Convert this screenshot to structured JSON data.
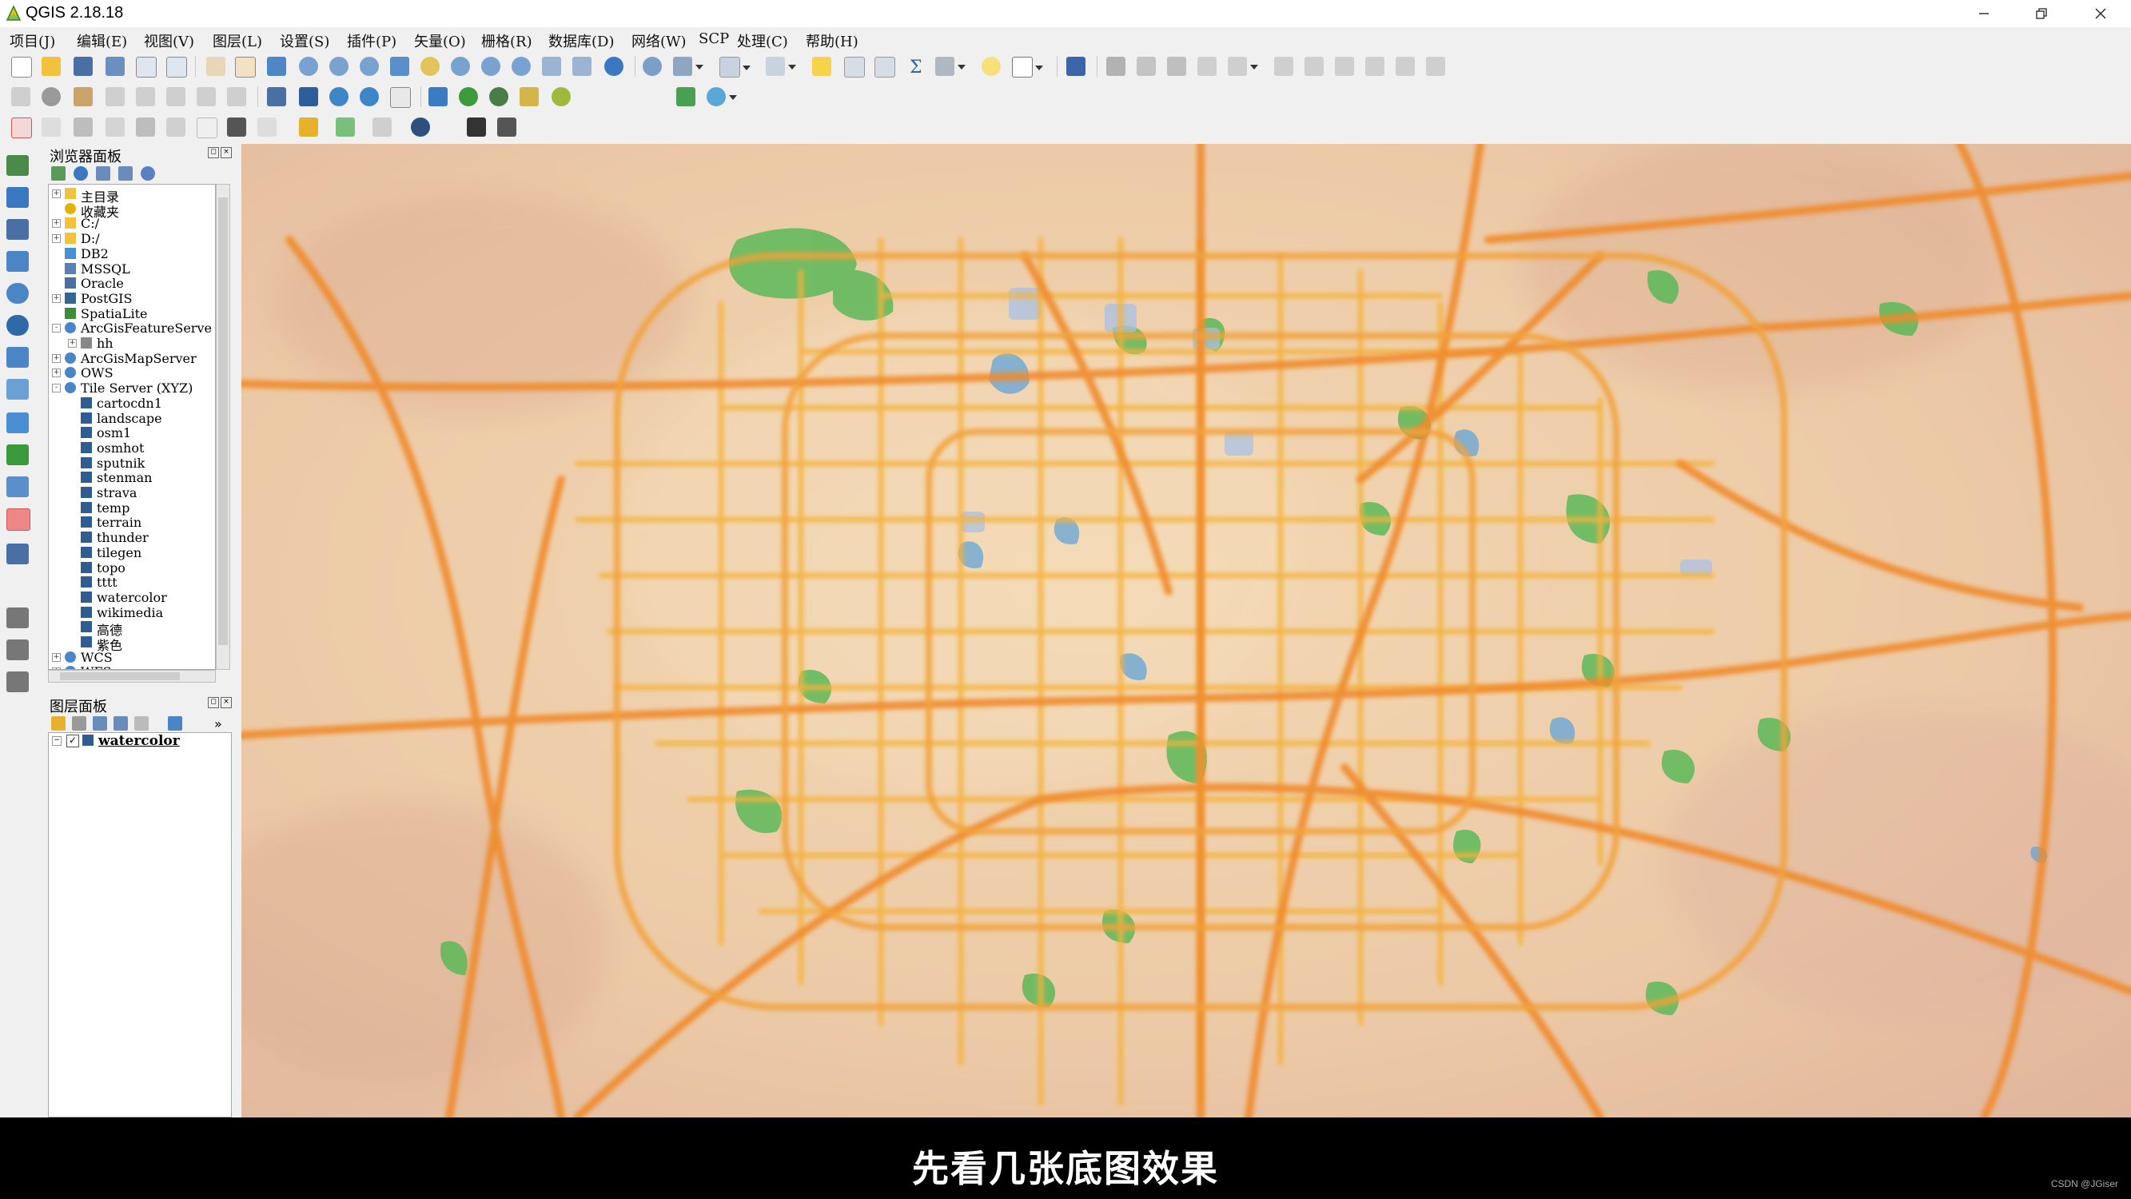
{
  "window": {
    "title": "QGIS 2.18.18"
  },
  "menu": [
    "项目(J)",
    "编辑(E)",
    "视图(V)",
    "图层(L)",
    "设置(S)",
    "插件(P)",
    "矢量(O)",
    "栅格(R)",
    "数据库(D)",
    "网络(W)",
    "SCP",
    "处理(C)",
    "帮助(H)"
  ],
  "browser_panel": {
    "title": "浏览器面板",
    "items": [
      {
        "label": "主目录",
        "level": 0,
        "expander": "+",
        "icon": "folder-icon"
      },
      {
        "label": "收藏夹",
        "level": 0,
        "expander": "",
        "icon": "star-icon"
      },
      {
        "label": "C:/",
        "level": 0,
        "expander": "+",
        "icon": "folder-icon"
      },
      {
        "label": "D:/",
        "level": 0,
        "expander": "+",
        "icon": "folder-icon"
      },
      {
        "label": "DB2",
        "level": 0,
        "expander": "",
        "icon": "db2-icon"
      },
      {
        "label": "MSSQL",
        "level": 0,
        "expander": "",
        "icon": "mssql-icon"
      },
      {
        "label": "Oracle",
        "level": 0,
        "expander": "",
        "icon": "oracle-icon"
      },
      {
        "label": "PostGIS",
        "level": 0,
        "expander": "+",
        "icon": "postgis-icon"
      },
      {
        "label": "SpatiaLite",
        "level": 0,
        "expander": "",
        "icon": "spatialite-icon"
      },
      {
        "label": "ArcGisFeatureServe",
        "level": 0,
        "expander": "-",
        "icon": "globe-icon"
      },
      {
        "label": "hh",
        "level": 1,
        "expander": "+",
        "icon": "connection-icon"
      },
      {
        "label": "ArcGisMapServer",
        "level": 0,
        "expander": "+",
        "icon": "globe-icon"
      },
      {
        "label": "OWS",
        "level": 0,
        "expander": "+",
        "icon": "globe-icon"
      },
      {
        "label": "Tile Server (XYZ)",
        "level": 0,
        "expander": "-",
        "icon": "globe-icon"
      },
      {
        "label": "cartocdn1",
        "level": 1,
        "expander": "",
        "icon": "tile-icon"
      },
      {
        "label": "landscape",
        "level": 1,
        "expander": "",
        "icon": "tile-icon"
      },
      {
        "label": "osm1",
        "level": 1,
        "expander": "",
        "icon": "tile-icon"
      },
      {
        "label": "osmhot",
        "level": 1,
        "expander": "",
        "icon": "tile-icon"
      },
      {
        "label": "sputnik",
        "level": 1,
        "expander": "",
        "icon": "tile-icon"
      },
      {
        "label": "stenman",
        "level": 1,
        "expander": "",
        "icon": "tile-icon"
      },
      {
        "label": "strava",
        "level": 1,
        "expander": "",
        "icon": "tile-icon"
      },
      {
        "label": "temp",
        "level": 1,
        "expander": "",
        "icon": "tile-icon"
      },
      {
        "label": "terrain",
        "level": 1,
        "expander": "",
        "icon": "tile-icon"
      },
      {
        "label": "thunder",
        "level": 1,
        "expander": "",
        "icon": "tile-icon"
      },
      {
        "label": "tilegen",
        "level": 1,
        "expander": "",
        "icon": "tile-icon"
      },
      {
        "label": "topo",
        "level": 1,
        "expander": "",
        "icon": "tile-icon"
      },
      {
        "label": "tttt",
        "level": 1,
        "expander": "",
        "icon": "tile-icon"
      },
      {
        "label": "watercolor",
        "level": 1,
        "expander": "",
        "icon": "tile-icon"
      },
      {
        "label": "wikimedia",
        "level": 1,
        "expander": "",
        "icon": "tile-icon"
      },
      {
        "label": "高德",
        "level": 1,
        "expander": "",
        "icon": "tile-icon"
      },
      {
        "label": "紫色",
        "level": 1,
        "expander": "",
        "icon": "tile-icon"
      },
      {
        "label": "WCS",
        "level": 0,
        "expander": "+",
        "icon": "globe-icon"
      },
      {
        "label": "WFS",
        "level": 0,
        "expander": "+",
        "icon": "globe-icon"
      }
    ]
  },
  "layers_panel": {
    "title": "图层面板",
    "layers": [
      {
        "label": "watercolor",
        "checked": true
      }
    ]
  },
  "caption": "先看几张底图效果",
  "watermark": "CSDN @JGiser",
  "colors": {
    "map_base": "#ecc9a6",
    "road_major": "#f08a2c",
    "road_minor": "#f5b23e",
    "park": "#5bb858",
    "water": "#6aa6d6"
  }
}
